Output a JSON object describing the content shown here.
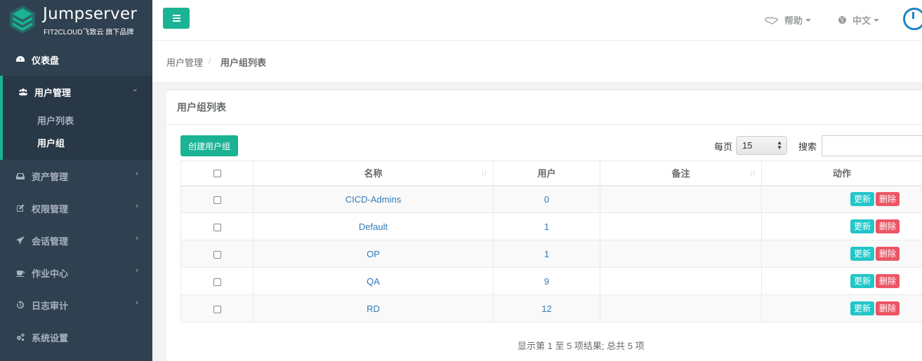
{
  "logo": {
    "title": "Jumpserver",
    "subtitle": "FIT2CLOUD飞致云 旗下品牌"
  },
  "sidebar": {
    "items": [
      {
        "label": "仪表盘",
        "icon": "dashboard-icon"
      },
      {
        "label": "用户管理",
        "icon": "users-icon",
        "arrow": "⌄"
      },
      {
        "label": "资产管理",
        "icon": "inbox-icon",
        "arrow": "‹"
      },
      {
        "label": "权限管理",
        "icon": "edit-icon",
        "arrow": "‹"
      },
      {
        "label": "会话管理",
        "icon": "rocket-icon",
        "arrow": "‹"
      },
      {
        "label": "作业中心",
        "icon": "coffee-icon",
        "arrow": "‹"
      },
      {
        "label": "日志审计",
        "icon": "history-icon",
        "arrow": "‹"
      },
      {
        "label": "系统设置",
        "icon": "gears-icon"
      }
    ],
    "subitems": [
      {
        "label": "用户列表"
      },
      {
        "label": "用户组"
      }
    ]
  },
  "topbar": {
    "help": "帮助",
    "language": "中文"
  },
  "breadcrumb": {
    "parent": "用户管理",
    "separator": "/",
    "current": "用户组列表"
  },
  "panel": {
    "title": "用户组列表",
    "create_button": "创建用户组",
    "per_page_label": "每页",
    "per_page_value": "15",
    "search_label": "搜索"
  },
  "table": {
    "headers": {
      "name": "名称",
      "users": "用户",
      "comment": "备注",
      "actions": "动作"
    },
    "rows": [
      {
        "name": "CICD-Admins",
        "users": "0",
        "comment": ""
      },
      {
        "name": "Default",
        "users": "1",
        "comment": ""
      },
      {
        "name": "OP",
        "users": "1",
        "comment": ""
      },
      {
        "name": "QA",
        "users": "9",
        "comment": ""
      },
      {
        "name": "RD",
        "users": "12",
        "comment": ""
      }
    ],
    "update_label": "更新",
    "delete_label": "删除",
    "sort_symbol": "↓↑"
  },
  "info": "显示第 1 至 5 项结果; 总共 5 项",
  "colors": {
    "sidebar": "#2f4050",
    "primary": "#1ab394",
    "info": "#23c6c8",
    "danger": "#ed5565",
    "link": "#337ab7"
  }
}
